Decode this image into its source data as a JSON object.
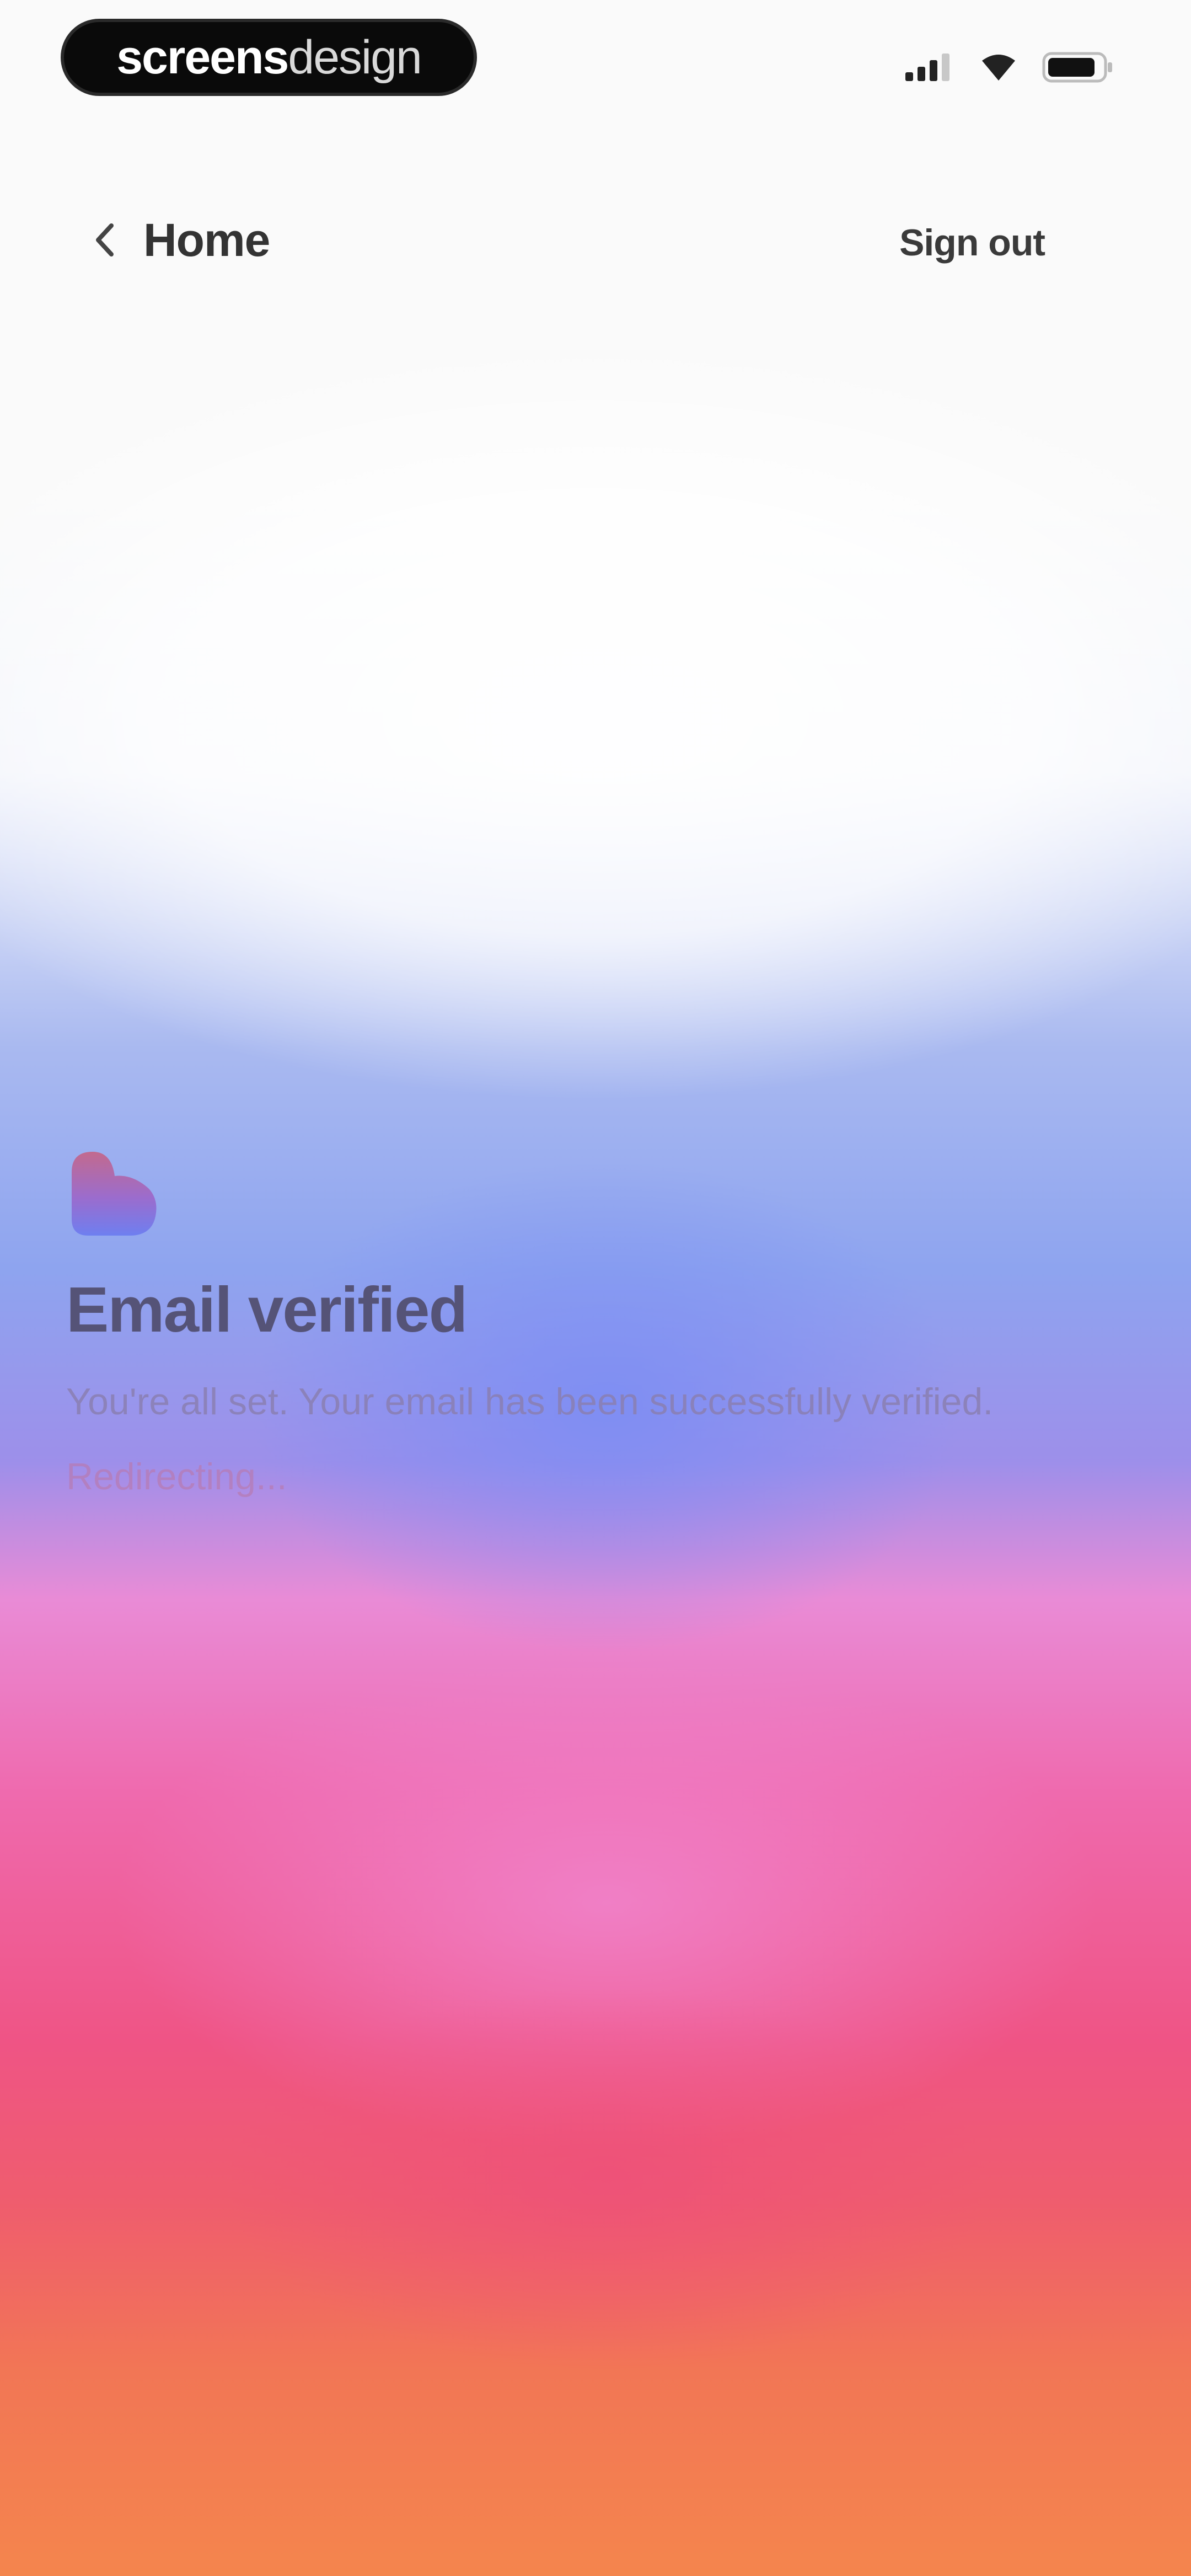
{
  "status_bar": {
    "brand_strong": "screens",
    "brand_light": "design",
    "icons": [
      "cellular-signal-icon",
      "wifi-icon",
      "battery-icon"
    ]
  },
  "nav": {
    "back_label": "Home",
    "sign_out_label": "Sign out"
  },
  "content": {
    "logo_icon": "heart-logo-icon",
    "title": "Email verified",
    "subtitle": "You're all set. Your email has been successfully verified.",
    "status": "Redirecting..."
  },
  "colors": {
    "title": "#555377",
    "logo_top": "#c26a8e",
    "logo_bottom": "#6e7ff0",
    "gradient_blue": "#8ea4ef",
    "gradient_pink": "#ef6aae",
    "gradient_orange": "#f4854d"
  }
}
